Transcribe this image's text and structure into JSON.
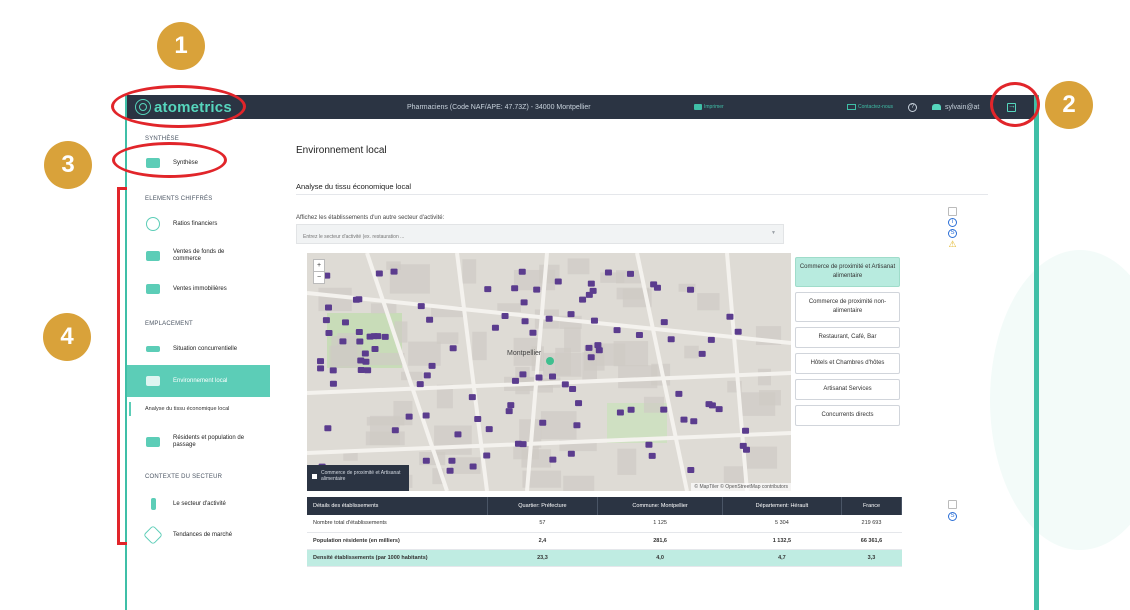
{
  "topbar": {
    "logo_text": "atometrics",
    "title": "Pharmaciens (Code NAF/APE: 47.73Z) - 34000 Montpellier",
    "print_label": "Imprimer",
    "contact_label": "Contactez-nous",
    "user_label": "sylvain@at"
  },
  "sidebar": {
    "sections": [
      {
        "title": "SYNTHÈSE"
      },
      {
        "title": "ELEMENTS CHIFFRÉS"
      },
      {
        "title": "EMPLACEMENT"
      },
      {
        "title": "CONTEXTE DU SECTEUR"
      }
    ],
    "items": [
      {
        "label": "Synthèse"
      },
      {
        "label": "Ratios financiers"
      },
      {
        "label": "Ventes de fonds de commerce"
      },
      {
        "label": "Ventes immobilières"
      },
      {
        "label": "Situation concurrentielle"
      },
      {
        "label": "Environnement local"
      },
      {
        "label": "Résidents et population de passage"
      },
      {
        "label": "Le secteur d'activité"
      },
      {
        "label": "Tendances de marché"
      }
    ],
    "sub_link": "Analyse du tissu économique local"
  },
  "main": {
    "title": "Environnement local",
    "section_title": "Analyse du tissu économique local",
    "prompt": "Affichez les établissements d'un autre secteur d'activité:",
    "search_placeholder": "Entrez le secteur d'activité (ex. restauration ...",
    "map": {
      "city_label": "Montpellier",
      "zoom_in": "+",
      "zoom_out": "−",
      "legend": "Commerce de proximité et Artisanat alimentaire",
      "attribution": "© MapTiler © OpenStreetMap contributors"
    },
    "categories": [
      {
        "label": "Commerce de proximité et Artisanat alimentaire",
        "active": true
      },
      {
        "label": "Commerce de proximité non-alimentaire",
        "active": false
      },
      {
        "label": "Restaurant, Café, Bar",
        "active": false
      },
      {
        "label": "Hôtels et Chambres d'hôtes",
        "active": false
      },
      {
        "label": "Artisanat Services",
        "active": false
      },
      {
        "label": "Concurrents directs",
        "active": false
      }
    ],
    "table": {
      "headers": [
        "Détails des établissements",
        "Quartier: Préfecture",
        "Commune: Montpellier",
        "Département: Hérault",
        "France"
      ],
      "rows": [
        [
          "Nombre total d'établissements",
          "57",
          "1 125",
          "5 304",
          "219 693"
        ],
        [
          "Population résidente (en milliers)",
          "2,4",
          "281,6",
          "1 132,5",
          "66 361,6"
        ],
        [
          "Densité établissements (par 1000 habitants)",
          "23,3",
          "4,0",
          "4,7",
          "3,3"
        ]
      ]
    }
  },
  "annotations": [
    "1",
    "2",
    "3",
    "4"
  ],
  "colors": {
    "accent": "#5ccdb7",
    "topbar": "#2b3443",
    "annotation_badge": "#d9a23a",
    "annotation_ring": "#e1252a",
    "map_marker": "#5b3c8e"
  }
}
